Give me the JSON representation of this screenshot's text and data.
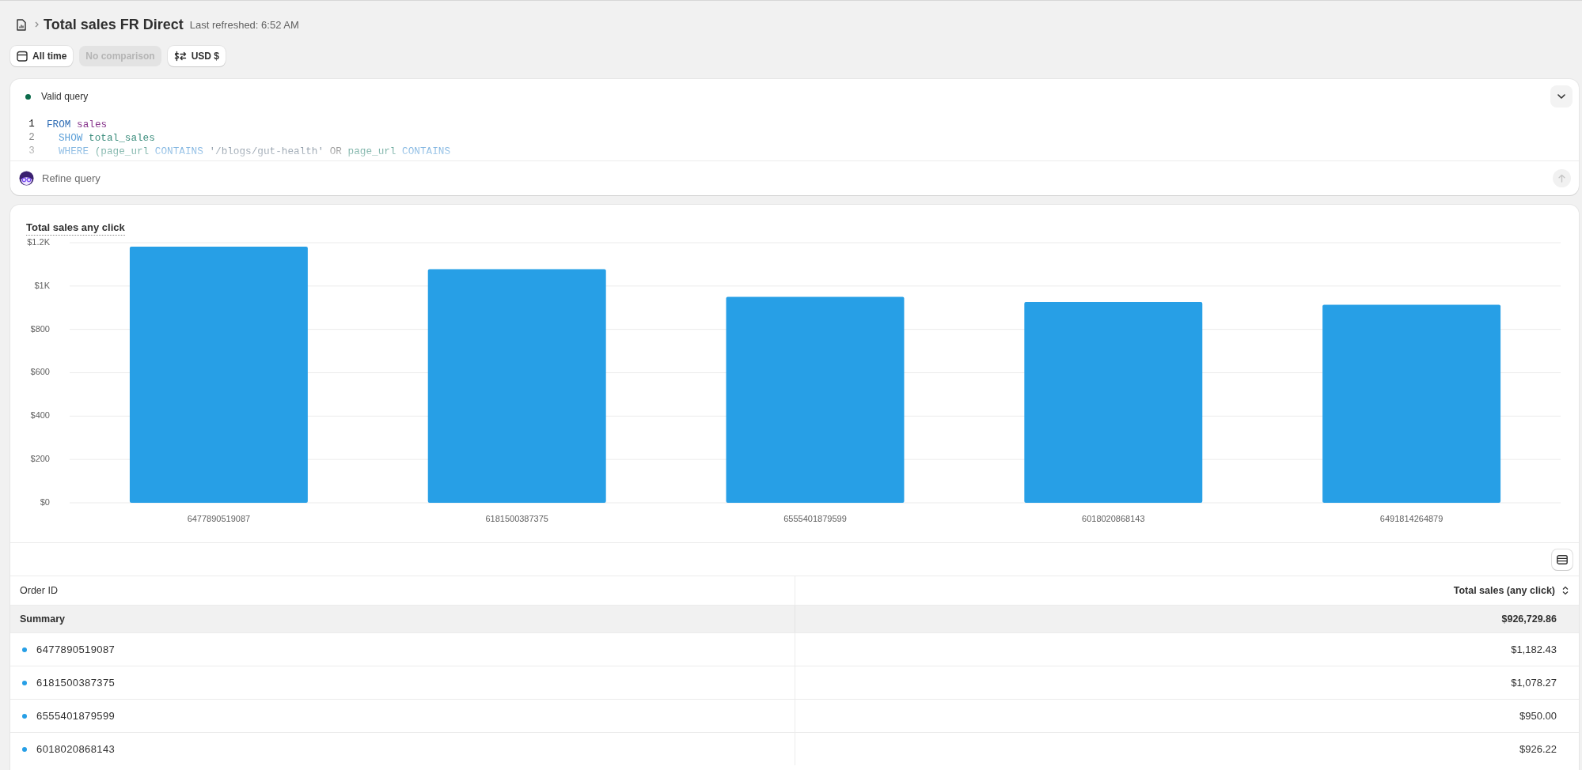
{
  "breadcrumb": {
    "title": "Total sales FR Direct",
    "last_refreshed": "Last refreshed: 6:52 AM"
  },
  "filters": [
    {
      "kind": "date",
      "label": "All time",
      "disabled": false
    },
    {
      "kind": "comparison",
      "label": "No comparison",
      "disabled": true
    },
    {
      "kind": "currency",
      "label": "USD $",
      "disabled": false
    }
  ],
  "query": {
    "status": {
      "label": "Valid query",
      "valid": true
    },
    "expanded": false,
    "lines": [
      {
        "number": "1",
        "active": true,
        "tokens": [
          {
            "kind": "source",
            "text": "FROM"
          },
          {
            "kind": "table",
            "text": "sales"
          }
        ],
        "children": [
          {
            "number": "2",
            "active": false,
            "tokens": [
              {
                "kind": "keyword",
                "text": "SHOW"
              },
              {
                "kind": "field",
                "text": "total_sales"
              }
            ]
          },
          {
            "number": "3",
            "active": false,
            "tokens": [
              {
                "kind": "keyword",
                "text": "WHERE"
              },
              {
                "kind": "field",
                "text": "(page_url"
              },
              {
                "kind": "keyword",
                "text": "CONTAINS"
              },
              {
                "kind": "string",
                "text": "'/blogs/gut-health'"
              },
              {
                "kind": "operator",
                "text": "OR"
              },
              {
                "kind": "field",
                "text": "page_url"
              },
              {
                "kind": "keyword",
                "text": "CONTAINS"
              }
            ]
          }
        ]
      }
    ],
    "refine": {
      "placeholder": "Refine query",
      "submit_disabled": true
    }
  },
  "chart": {
    "chart_data": {
      "type": "bar",
      "title": "Total sales any click",
      "categories": [
        "6477890519087",
        "6181500387375",
        "6555401879599",
        "6018020868143",
        "6491814264879"
      ],
      "series": [
        {
          "color": "#279fe6",
          "values": [
            1182,
            1078,
            950,
            926,
            914
          ]
        }
      ],
      "ylim": [
        0,
        1200
      ],
      "yticks": [
        {
          "value": 0,
          "label": "$0"
        },
        {
          "value": 200,
          "label": "$200"
        },
        {
          "value": 400,
          "label": "$400"
        },
        {
          "value": 600,
          "label": "$600"
        },
        {
          "value": 800,
          "label": "$800"
        },
        {
          "value": 1000,
          "label": "$1K"
        },
        {
          "value": 1200,
          "label": "$1.2K"
        }
      ],
      "grid": true
    }
  },
  "table": {
    "columns": [
      {
        "label": "Order ID",
        "sortable": false
      },
      {
        "label": "Total sales (any click)",
        "sortable": true
      }
    ],
    "summary": {
      "label": "Summary",
      "value": "$926,729.86"
    },
    "rows": [
      {
        "order_id": "6477890519087",
        "total_sales": "$1,182.43"
      },
      {
        "order_id": "6181500387375",
        "total_sales": "$1,078.27"
      },
      {
        "order_id": "6555401879599",
        "total_sales": "$950.00"
      },
      {
        "order_id": "6018020868143",
        "total_sales": "$926.22"
      }
    ]
  }
}
